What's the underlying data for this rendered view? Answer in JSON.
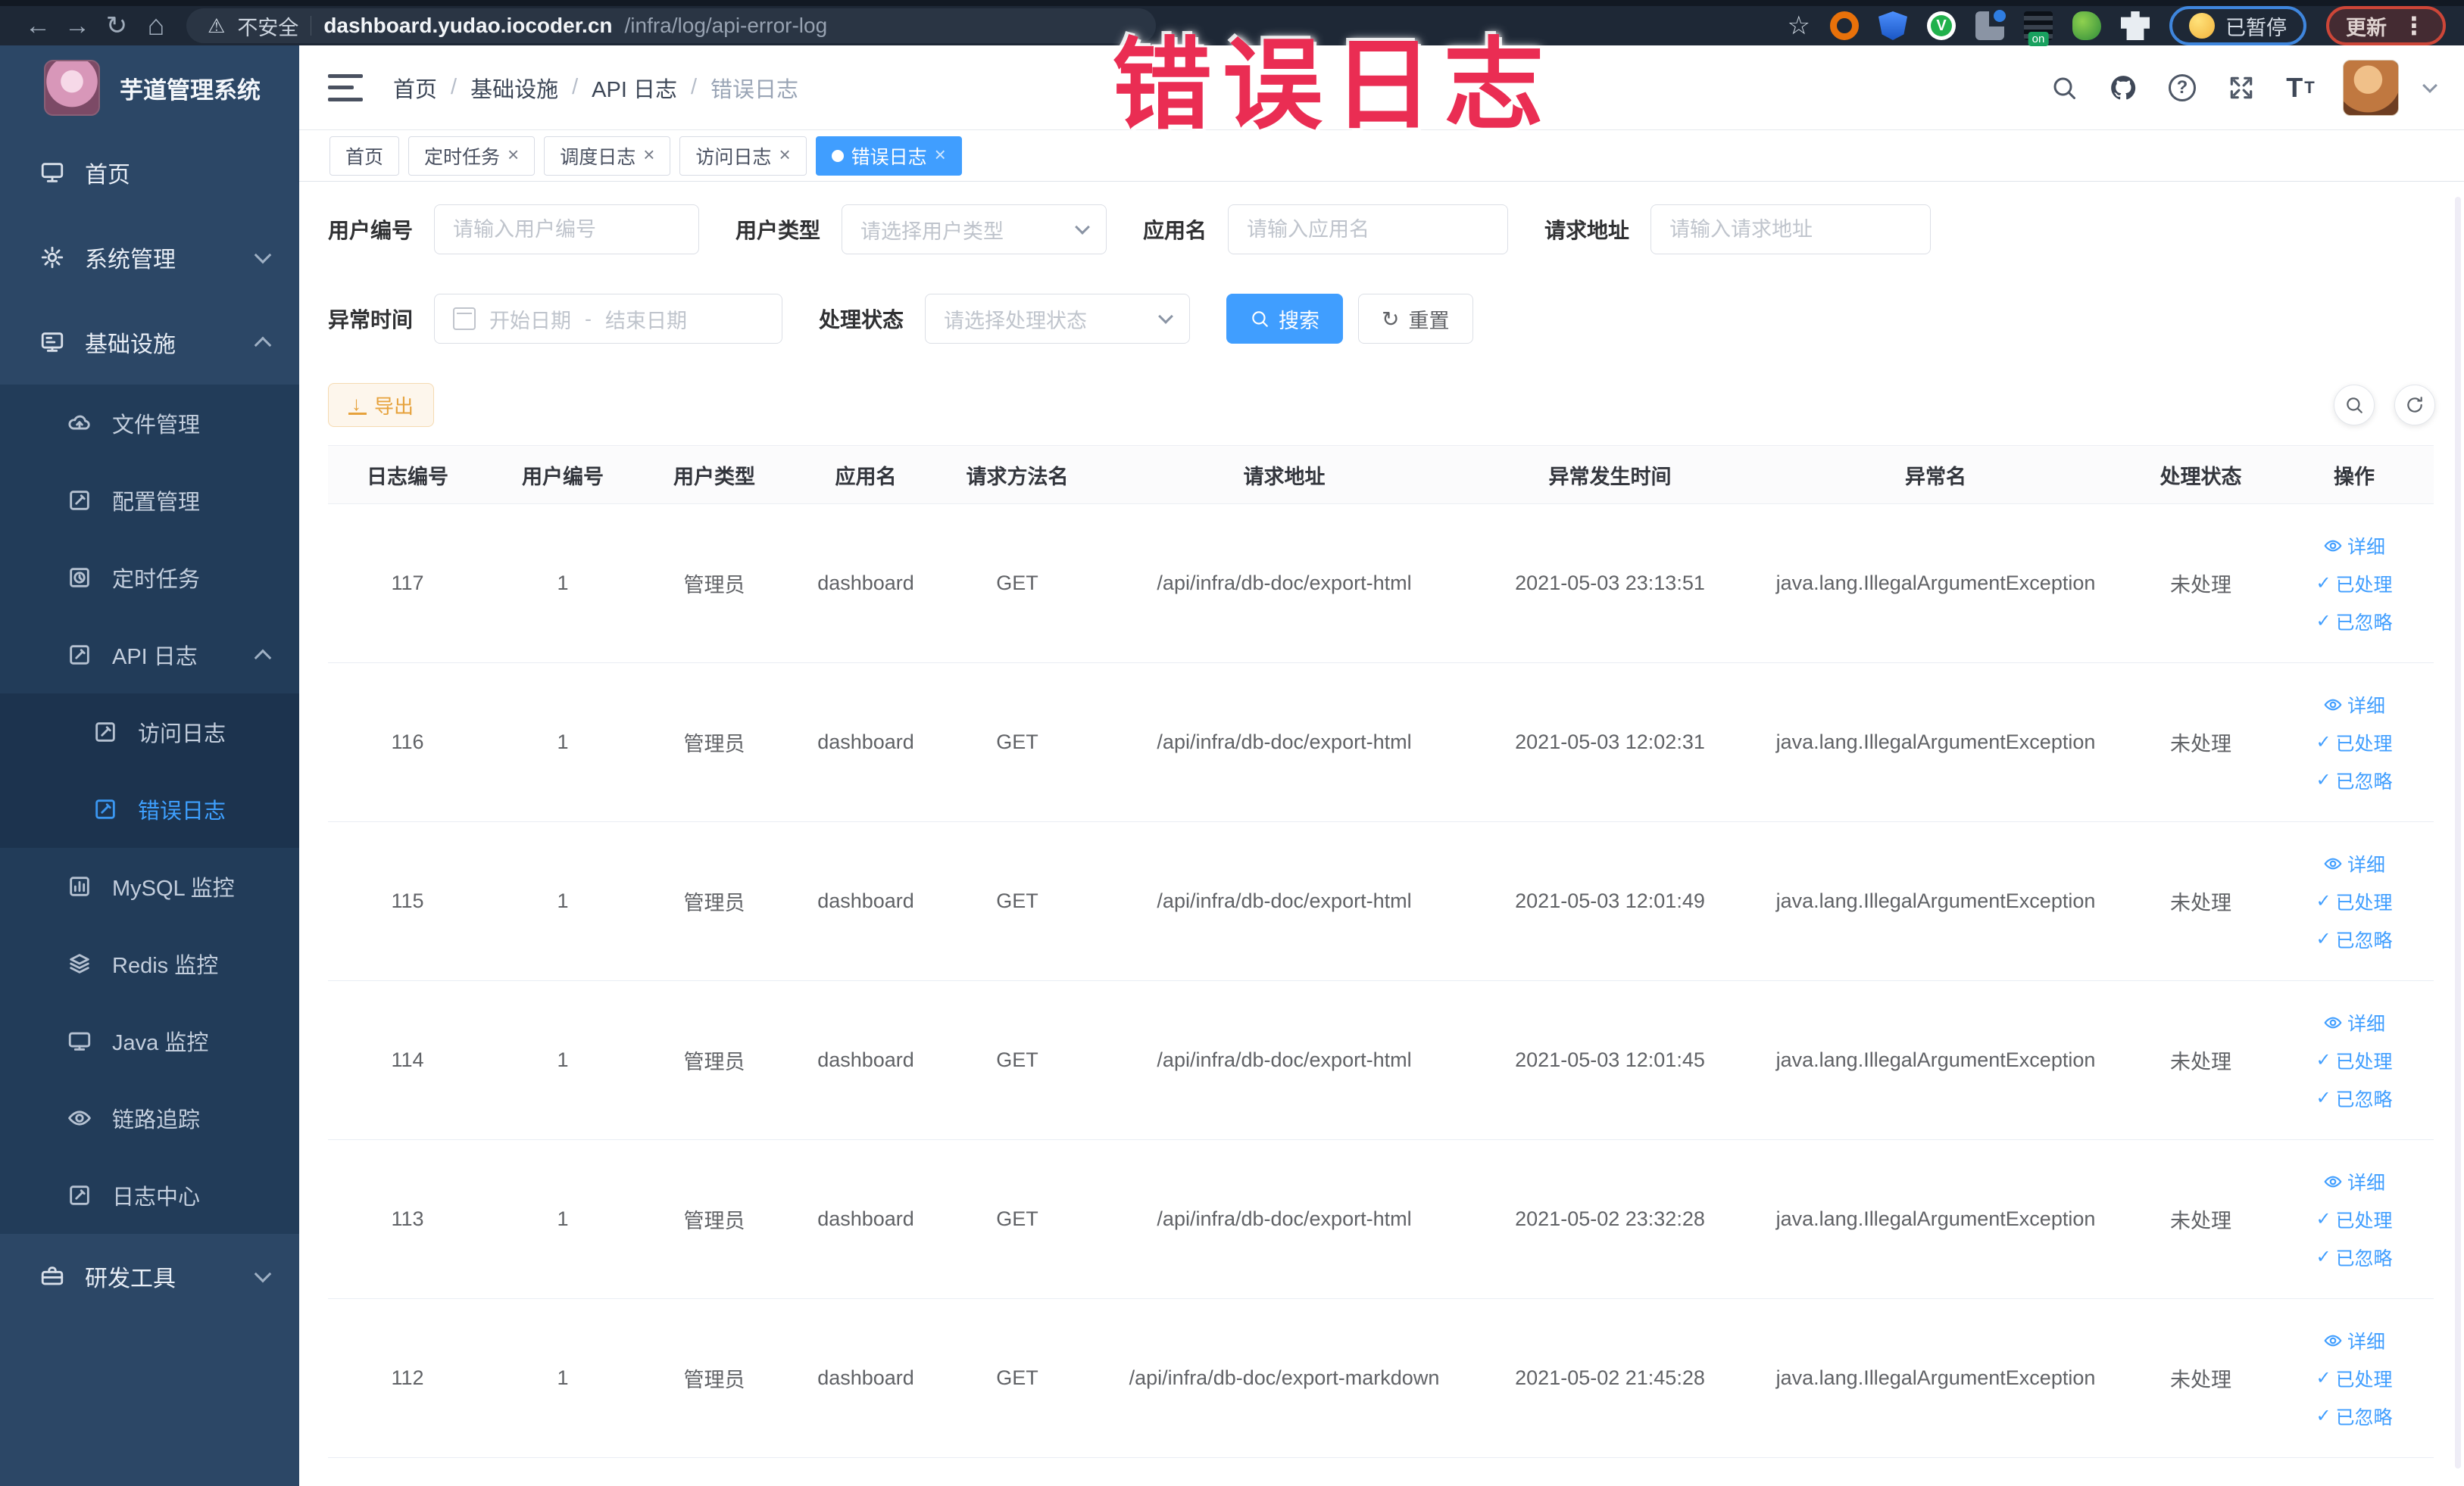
{
  "browser": {
    "security_label": "不安全",
    "url_host": "dashboard.yudao.iocoder.cn",
    "url_path": "/infra/log/api-error-log",
    "on_badge": "on",
    "paused_label": "已暂停",
    "update_label": "更新"
  },
  "watermark": {
    "text": "错误日志",
    "color": "#ea2d53"
  },
  "sidebar": {
    "app_title": "芋道管理系统",
    "items": [
      {
        "label": "首页"
      },
      {
        "label": "系统管理"
      },
      {
        "label": "基础设施"
      },
      {
        "label": "文件管理"
      },
      {
        "label": "配置管理"
      },
      {
        "label": "定时任务"
      },
      {
        "label": "API 日志"
      },
      {
        "label": "访问日志"
      },
      {
        "label": "错误日志"
      },
      {
        "label": "MySQL 监控"
      },
      {
        "label": "Redis 监控"
      },
      {
        "label": "Java 监控"
      },
      {
        "label": "链路追踪"
      },
      {
        "label": "日志中心"
      },
      {
        "label": "研发工具"
      }
    ]
  },
  "breadcrumb": {
    "separator": "/",
    "items": [
      "首页",
      "基础设施",
      "API 日志",
      "错误日志"
    ]
  },
  "tabs": [
    {
      "label": "首页"
    },
    {
      "label": "定时任务"
    },
    {
      "label": "调度日志"
    },
    {
      "label": "访问日志"
    },
    {
      "label": "错误日志"
    }
  ],
  "filters": {
    "user_id_label": "用户编号",
    "user_id_placeholder": "请输入用户编号",
    "user_type_label": "用户类型",
    "user_type_placeholder": "请选择用户类型",
    "app_name_label": "应用名",
    "app_name_placeholder": "请输入应用名",
    "request_url_label": "请求地址",
    "request_url_placeholder": "请输入请求地址",
    "exception_time_label": "异常时间",
    "date_start_placeholder": "开始日期",
    "date_separator": "-",
    "date_end_placeholder": "结束日期",
    "process_status_label": "处理状态",
    "process_status_placeholder": "请选择处理状态",
    "search_button": "搜索",
    "reset_button": "重置"
  },
  "toolbar": {
    "export_button": "导出"
  },
  "table": {
    "columns": [
      "日志编号",
      "用户编号",
      "用户类型",
      "应用名",
      "请求方法名",
      "请求地址",
      "异常发生时间",
      "异常名",
      "处理状态",
      "操作"
    ],
    "actions": {
      "detail": "详细",
      "processed": "已处理",
      "ignored": "已忽略"
    },
    "rows": [
      {
        "log_id": "117",
        "user_id": "1",
        "user_type": "管理员",
        "app_name": "dashboard",
        "method": "GET",
        "request_url": "/api/infra/db-doc/export-html",
        "error_time": "2021-05-03 23:13:51",
        "exception_name": "java.lang.IllegalArgumentException",
        "status": "未处理"
      },
      {
        "log_id": "116",
        "user_id": "1",
        "user_type": "管理员",
        "app_name": "dashboard",
        "method": "GET",
        "request_url": "/api/infra/db-doc/export-html",
        "error_time": "2021-05-03 12:02:31",
        "exception_name": "java.lang.IllegalArgumentException",
        "status": "未处理"
      },
      {
        "log_id": "115",
        "user_id": "1",
        "user_type": "管理员",
        "app_name": "dashboard",
        "method": "GET",
        "request_url": "/api/infra/db-doc/export-html",
        "error_time": "2021-05-03 12:01:49",
        "exception_name": "java.lang.IllegalArgumentException",
        "status": "未处理"
      },
      {
        "log_id": "114",
        "user_id": "1",
        "user_type": "管理员",
        "app_name": "dashboard",
        "method": "GET",
        "request_url": "/api/infra/db-doc/export-html",
        "error_time": "2021-05-03 12:01:45",
        "exception_name": "java.lang.IllegalArgumentException",
        "status": "未处理"
      },
      {
        "log_id": "113",
        "user_id": "1",
        "user_type": "管理员",
        "app_name": "dashboard",
        "method": "GET",
        "request_url": "/api/infra/db-doc/export-html",
        "error_time": "2021-05-02 23:32:28",
        "exception_name": "java.lang.IllegalArgumentException",
        "status": "未处理"
      },
      {
        "log_id": "112",
        "user_id": "1",
        "user_type": "管理员",
        "app_name": "dashboard",
        "method": "GET",
        "request_url": "/api/infra/db-doc/export-markdown",
        "error_time": "2021-05-02 21:45:28",
        "exception_name": "java.lang.IllegalArgumentException",
        "status": "未处理"
      }
    ]
  }
}
